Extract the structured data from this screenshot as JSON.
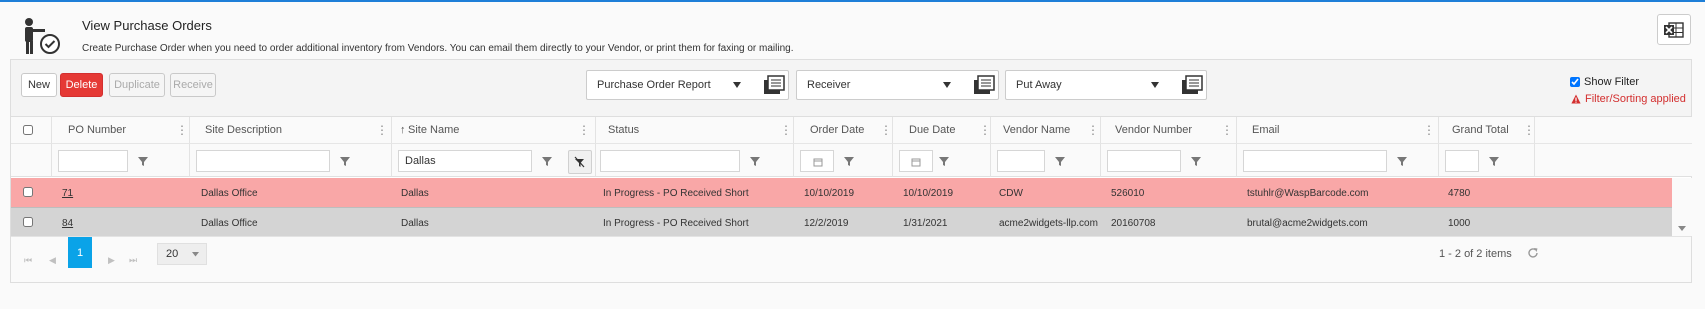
{
  "header": {
    "title": "View Purchase Orders",
    "description": "Create Purchase Order when you need to order additional inventory from Vendors. You can email them directly to your Vendor, or print them for faxing or mailing."
  },
  "toolbar": {
    "new_label": "New",
    "delete_label": "Delete",
    "duplicate_label": "Duplicate",
    "receive_label": "Receive",
    "reports": [
      "Purchase Order Report",
      "Receiver",
      "Put Away"
    ],
    "show_filter_label": "Show Filter",
    "show_filter_checked": true,
    "filter_applied_label": "Filter/Sorting applied"
  },
  "grid": {
    "columns": [
      "PO Number",
      "Site Description",
      "Site Name",
      "Status",
      "Order Date",
      "Due Date",
      "Vendor Name",
      "Vendor Number",
      "Email",
      "Grand Total"
    ],
    "sorted_column": "Site Name",
    "filters": {
      "site_name": "Dallas"
    },
    "rows": [
      {
        "po_number": "71",
        "site_description": "Dallas Office",
        "site_name": "Dallas",
        "status": "In Progress - PO Received Short",
        "order_date": "10/10/2019",
        "due_date": "10/10/2019",
        "vendor_name": "CDW",
        "vendor_number": "526010",
        "email": "tstuhlr@WaspBarcode.com",
        "grand_total": "4780"
      },
      {
        "po_number": "84",
        "site_description": "Dallas Office",
        "site_name": "Dallas",
        "status": "In Progress - PO Received Short",
        "order_date": "12/2/2019",
        "due_date": "1/31/2021",
        "vendor_name": "acme2widgets-llp.com",
        "vendor_number": "20160708",
        "email": "brutal@acme2widgets.com",
        "grand_total": "1000"
      }
    ]
  },
  "pager": {
    "current_page": "1",
    "page_size": "20",
    "info": "1 - 2 of 2 items"
  },
  "colors": {
    "accent": "#1e7fd8",
    "delete": "#e53935",
    "highlight_row": "#f9a7a7",
    "selected_row": "#d4d4d4",
    "pager_active": "#0aa3e8",
    "warning": "#d32f2f"
  }
}
